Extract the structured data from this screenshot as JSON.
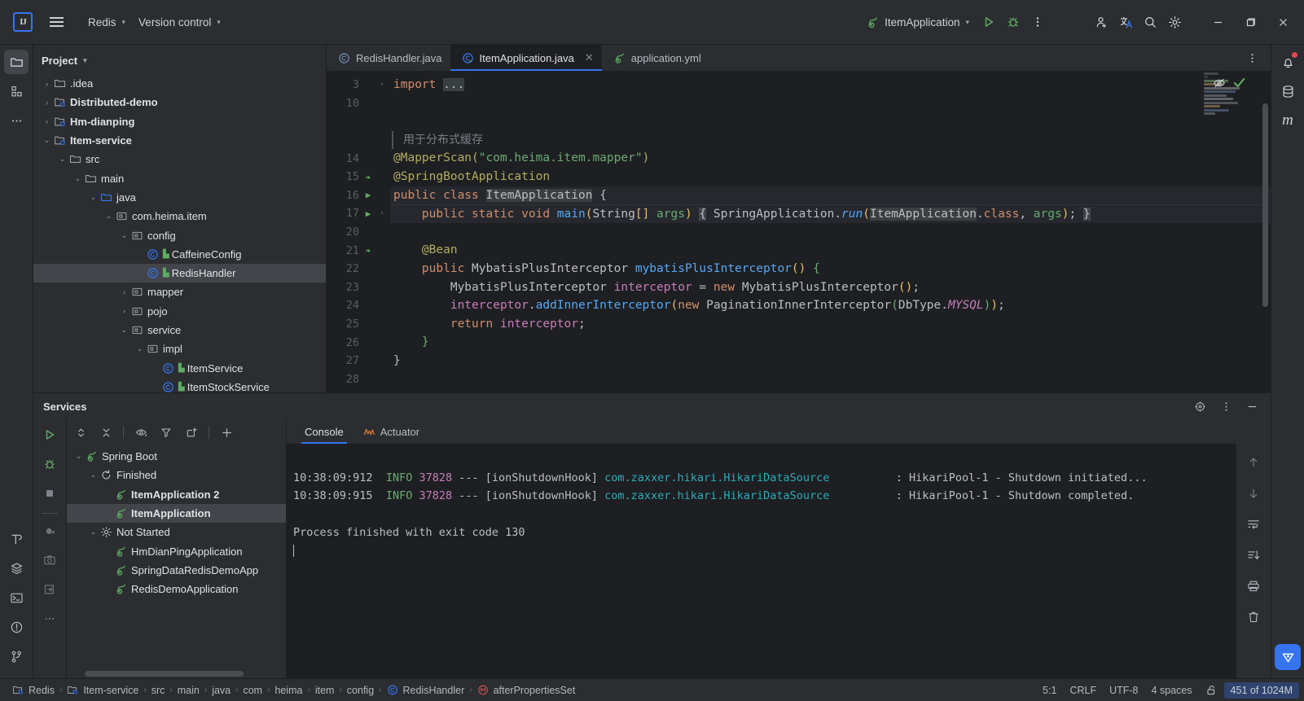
{
  "titlebar": {
    "logo": "IJ",
    "menu_icon": "hamburger-icon",
    "project_name": "Redis",
    "vcs_label": "Version control",
    "run_config_name": "ItemApplication",
    "icons": {
      "run": "run-icon",
      "debug": "debug-icon",
      "more": "more-vertical-icon",
      "add_user": "add-user-icon",
      "translate": "translate-icon",
      "search": "search-icon",
      "settings": "gear-icon",
      "minimize": "minimize-icon",
      "maximize": "maximize-icon",
      "close": "close-icon"
    }
  },
  "left_rail": [
    {
      "name": "project-tool-window",
      "icon": "folder-icon",
      "active": true
    },
    {
      "name": "structure-tool-window",
      "icon": "modules-icon",
      "active": false
    },
    {
      "name": "more-tool-windows",
      "icon": "ellipsis-icon",
      "active": false
    }
  ],
  "left_rail_bottom": [
    {
      "name": "build-tool-window",
      "icon": "hammer-icon"
    },
    {
      "name": "services-tool-window",
      "icon": "layers-icon"
    },
    {
      "name": "terminal-tool-window",
      "icon": "terminal-icon"
    },
    {
      "name": "problems-tool-window",
      "icon": "warning-circle-icon"
    },
    {
      "name": "version-control-tool-window",
      "icon": "branch-icon"
    }
  ],
  "right_rail": [
    {
      "name": "notifications",
      "icon": "bell-icon",
      "badge": true
    },
    {
      "name": "database",
      "icon": "database-icon",
      "badge": false
    },
    {
      "name": "maven",
      "icon": "maven-m-icon",
      "badge": false
    }
  ],
  "project": {
    "title": "Project",
    "tree": [
      {
        "label": ".idea",
        "indent": 1,
        "arrow": "collapsed",
        "icon": "folder-icon",
        "bold": false,
        "selected": false
      },
      {
        "label": "Distributed-demo",
        "indent": 1,
        "arrow": "collapsed",
        "icon": "module-icon",
        "bold": true,
        "selected": false
      },
      {
        "label": "Hm-dianping",
        "indent": 1,
        "arrow": "collapsed",
        "icon": "module-icon",
        "bold": true,
        "selected": false
      },
      {
        "label": "Item-service",
        "indent": 1,
        "arrow": "expanded",
        "icon": "module-icon",
        "bold": true,
        "selected": false
      },
      {
        "label": "src",
        "indent": 2,
        "arrow": "expanded",
        "icon": "folder-icon",
        "bold": false,
        "selected": false
      },
      {
        "label": "main",
        "indent": 3,
        "arrow": "expanded",
        "icon": "folder-icon",
        "bold": false,
        "selected": false
      },
      {
        "label": "java",
        "indent": 4,
        "arrow": "expanded",
        "icon": "source-folder-icon",
        "bold": false,
        "selected": false
      },
      {
        "label": "com.heima.item",
        "indent": 5,
        "arrow": "expanded",
        "icon": "package-icon",
        "bold": false,
        "selected": false
      },
      {
        "label": "config",
        "indent": 6,
        "arrow": "expanded",
        "icon": "package-icon",
        "bold": false,
        "selected": false
      },
      {
        "label": "CaffeineConfig",
        "indent": 7,
        "arrow": "none",
        "icon": "class-icon",
        "bold": false,
        "selected": false
      },
      {
        "label": "RedisHandler",
        "indent": 7,
        "arrow": "none",
        "icon": "class-icon",
        "bold": false,
        "selected": true
      },
      {
        "label": "mapper",
        "indent": 6,
        "arrow": "collapsed",
        "icon": "package-icon",
        "bold": false,
        "selected": false
      },
      {
        "label": "pojo",
        "indent": 6,
        "arrow": "collapsed",
        "icon": "package-icon",
        "bold": false,
        "selected": false
      },
      {
        "label": "service",
        "indent": 6,
        "arrow": "expanded",
        "icon": "package-icon",
        "bold": false,
        "selected": false
      },
      {
        "label": "impl",
        "indent": 7,
        "arrow": "expanded",
        "icon": "package-icon",
        "bold": false,
        "selected": false
      },
      {
        "label": "ItemService",
        "indent": 8,
        "arrow": "none",
        "icon": "class-icon",
        "bold": false,
        "selected": false
      },
      {
        "label": "ItemStockService",
        "indent": 8,
        "arrow": "none",
        "icon": "class-icon",
        "bold": false,
        "selected": false
      }
    ]
  },
  "editor": {
    "tabs": [
      {
        "label": "RedisHandler.java",
        "icon": "java-class-icon",
        "active": false,
        "closable": false
      },
      {
        "label": "ItemApplication.java",
        "icon": "spring-class-icon",
        "active": true,
        "closable": true
      },
      {
        "label": "application.yml",
        "icon": "spring-yaml-icon",
        "active": false,
        "closable": false
      }
    ],
    "tab_overflow_icon": "more-vertical-icon",
    "inspection_icons": {
      "hide": "eye-crossed-icon",
      "ok": "check-icon"
    },
    "lines": [
      {
        "num": "3",
        "fold": "collapsed",
        "mark": "",
        "highlight": false
      },
      {
        "num": "10",
        "fold": "",
        "mark": "",
        "highlight": false
      },
      {
        "num": "",
        "fold": "",
        "mark": "",
        "highlight": false
      },
      {
        "num": "",
        "fold": "",
        "mark": "",
        "highlight": false
      },
      {
        "num": "14",
        "fold": "",
        "mark": "",
        "highlight": false
      },
      {
        "num": "15",
        "fold": "",
        "mark": "bean-icon",
        "highlight": false
      },
      {
        "num": "16",
        "fold": "",
        "mark": "run-gutter-icon",
        "highlight": true
      },
      {
        "num": "17",
        "fold": "expanded",
        "mark": "run-gutter-icon",
        "highlight": true
      },
      {
        "num": "20",
        "fold": "",
        "mark": "",
        "highlight": false
      },
      {
        "num": "21",
        "fold": "",
        "mark": "bean-gutter-icon",
        "highlight": false
      },
      {
        "num": "22",
        "fold": "",
        "mark": "",
        "highlight": false
      },
      {
        "num": "23",
        "fold": "",
        "mark": "",
        "highlight": false
      },
      {
        "num": "24",
        "fold": "",
        "mark": "",
        "highlight": false
      },
      {
        "num": "25",
        "fold": "",
        "mark": "",
        "highlight": false
      },
      {
        "num": "26",
        "fold": "",
        "mark": "",
        "highlight": false
      },
      {
        "num": "27",
        "fold": "",
        "mark": "",
        "highlight": false
      },
      {
        "num": "28",
        "fold": "",
        "mark": "",
        "highlight": false
      }
    ],
    "code_text": {
      "l3": "import ...",
      "l_comment": "用于分布式缓存",
      "l14": "@MapperScan(\"com.heima.item.mapper\")",
      "l15": "@SpringBootApplication",
      "l16": "public class ItemApplication {",
      "l17": "    public static void main(String[] args) { SpringApplication.run(ItemApplication.class, args); }",
      "l21": "    @Bean",
      "l22": "    public MybatisPlusInterceptor mybatisPlusInterceptor() {",
      "l23": "        MybatisPlusInterceptor interceptor = new MybatisPlusInterceptor();",
      "l24": "        interceptor.addInnerInterceptor(new PaginationInnerInterceptor(DbType.MYSQL));",
      "l25": "        return interceptor;",
      "l26": "    }",
      "l27": "}"
    }
  },
  "services": {
    "title": "Services",
    "head_icons": {
      "help": "target-icon",
      "options": "more-vertical-icon",
      "hide": "minimize-icon"
    },
    "toolbar": [
      {
        "name": "rerun-service-button",
        "icon": "run-icon"
      },
      {
        "name": "expand-collapse-button",
        "icon": "expand-collapse-icon"
      },
      {
        "name": "collapse-all-button",
        "icon": "collapse-all-icon"
      },
      {
        "name": "show-hide-button",
        "icon": "eye-icon"
      },
      {
        "name": "filter-button",
        "icon": "filter-icon"
      },
      {
        "name": "open-in-tab-button",
        "icon": "open-tab-icon"
      },
      {
        "name": "add-service-button",
        "icon": "plus-icon"
      }
    ],
    "tree": [
      {
        "label": "Spring Boot",
        "indent": 1,
        "arrow": "expanded",
        "icon": "spring-icon",
        "bold": false,
        "selected": false
      },
      {
        "label": "Finished",
        "indent": 2,
        "arrow": "expanded",
        "icon": "refresh-icon",
        "bold": false,
        "selected": false
      },
      {
        "label": "ItemApplication 2",
        "indent": 3,
        "arrow": "none",
        "icon": "spring-icon",
        "bold": true,
        "selected": false
      },
      {
        "label": "ItemApplication",
        "indent": 3,
        "arrow": "none",
        "icon": "spring-icon",
        "bold": true,
        "selected": true
      },
      {
        "label": "Not Started",
        "indent": 2,
        "arrow": "expanded",
        "icon": "gear-icon",
        "bold": false,
        "selected": false
      },
      {
        "label": "HmDianPingApplication",
        "indent": 3,
        "arrow": "none",
        "icon": "spring-icon",
        "bold": false,
        "selected": false
      },
      {
        "label": "SpringDataRedisDemoApp",
        "indent": 3,
        "arrow": "none",
        "icon": "spring-icon",
        "bold": false,
        "selected": false
      },
      {
        "label": "RedisDemoApplication",
        "indent": 3,
        "arrow": "none",
        "icon": "spring-icon",
        "bold": false,
        "selected": false
      }
    ],
    "console_tabs": [
      {
        "label": "Console",
        "icon": "",
        "active": true
      },
      {
        "label": "Actuator",
        "icon": "actuator-icon",
        "active": false
      }
    ],
    "console_lines": [
      {
        "time": "10:38:09:912",
        "level": "INFO",
        "pid": "37828",
        "dash": "---",
        "thread": "[ionShutdownHook]",
        "logger": "com.zaxxer.hikari.HikariDataSource",
        "message": ": HikariPool-1 - Shutdown initiated..."
      },
      {
        "time": "10:38:09:915",
        "level": "INFO",
        "pid": "37828",
        "dash": "---",
        "thread": "[ionShutdownHook]",
        "logger": "com.zaxxer.hikari.HikariDataSource",
        "message": ": HikariPool-1 - Shutdown completed."
      }
    ],
    "exit_message": "Process finished with exit code 130",
    "console_rail": [
      {
        "name": "scroll-up-button",
        "icon": "arrow-up-icon"
      },
      {
        "name": "scroll-down-button",
        "icon": "arrow-down-icon"
      },
      {
        "name": "soft-wrap-button",
        "icon": "soft-wrap-icon"
      },
      {
        "name": "scroll-to-end-button",
        "icon": "scroll-end-icon"
      },
      {
        "name": "print-button",
        "icon": "printer-icon"
      },
      {
        "name": "clear-all-button",
        "icon": "trash-icon"
      }
    ]
  },
  "run_rail": [
    {
      "name": "rerun-button",
      "icon": "run-icon"
    },
    {
      "name": "debug-button",
      "icon": "debug-icon"
    },
    {
      "name": "stop-button",
      "icon": "stop-icon"
    },
    {
      "name": "attach-debugger-button",
      "icon": "attach-debug-icon"
    },
    {
      "name": "screenshot-button",
      "icon": "camera-icon"
    },
    {
      "name": "export-button",
      "icon": "export-icon"
    },
    {
      "name": "more-run-options",
      "icon": "ellipsis-icon"
    }
  ],
  "statusbar": {
    "breadcrumbs": [
      {
        "label": "Redis",
        "icon": "module-icon"
      },
      {
        "label": "Item-service",
        "icon": "module-icon"
      },
      {
        "label": "src",
        "icon": ""
      },
      {
        "label": "main",
        "icon": ""
      },
      {
        "label": "java",
        "icon": ""
      },
      {
        "label": "com",
        "icon": ""
      },
      {
        "label": "heima",
        "icon": ""
      },
      {
        "label": "item",
        "icon": ""
      },
      {
        "label": "config",
        "icon": ""
      },
      {
        "label": "RedisHandler",
        "icon": "class-icon"
      },
      {
        "label": "afterPropertiesSet",
        "icon": "method-icon"
      }
    ],
    "separator": "›",
    "yapi_icon": "y-icon",
    "caret_position": "5:1",
    "line_separator": "CRLF",
    "encoding": "UTF-8",
    "indent": "4 spaces",
    "lock_icon": "unlock-icon",
    "memory": "451 of 1024M"
  },
  "colors": {
    "accent": "#3574f0",
    "bg_dark": "#1e1f22",
    "bg_panel": "#2b2d30",
    "selection": "#43454a",
    "green": "#5fad65",
    "string": "#6aab73",
    "keyword": "#cf8e6d",
    "annotation": "#b3ae60",
    "method": "#56a8f5",
    "field": "#c77dbb",
    "number": "#2aacb8",
    "error": "#e5484d"
  }
}
